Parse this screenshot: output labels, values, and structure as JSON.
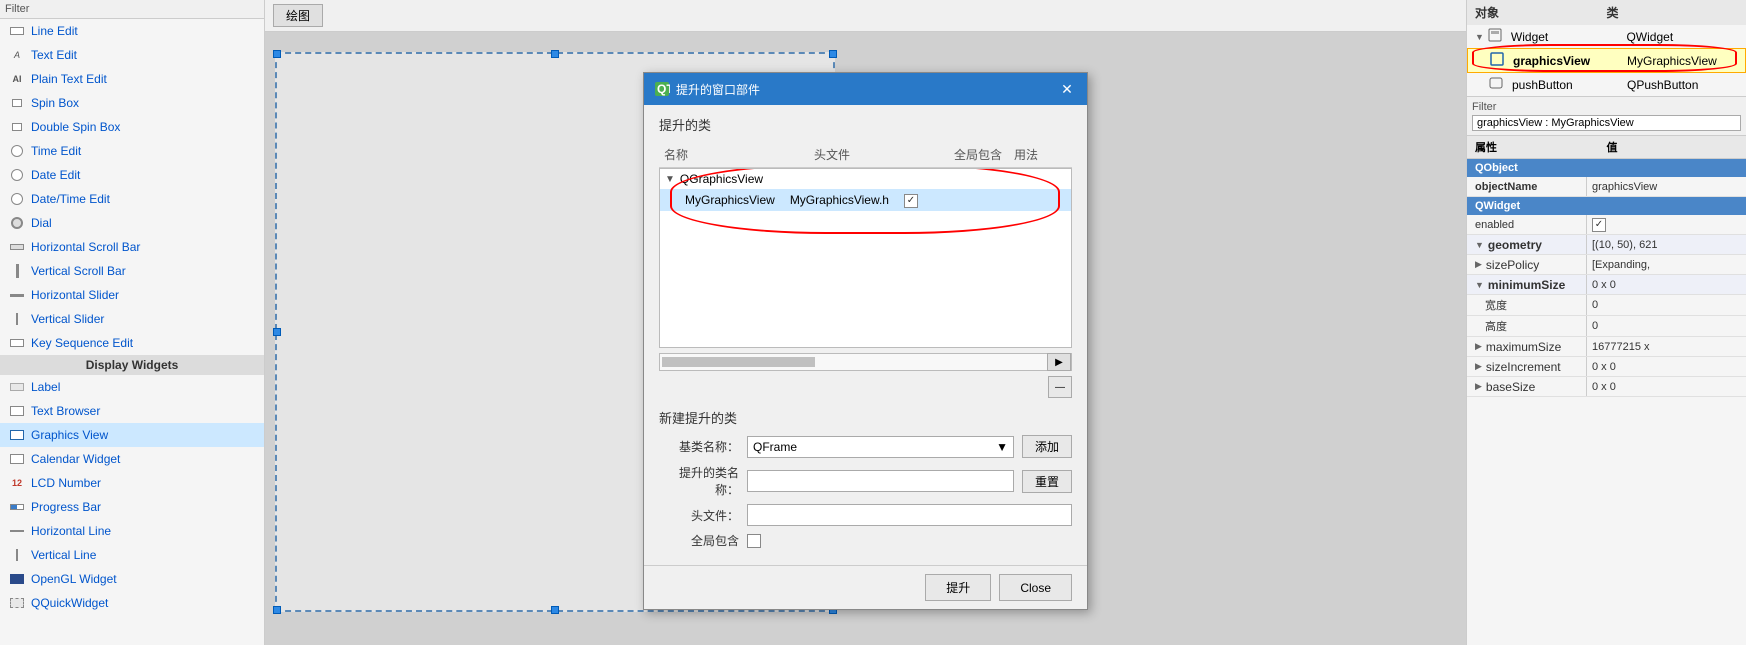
{
  "sidebar": {
    "filter_label": "Filter",
    "items": [
      {
        "id": "line-edit",
        "label": "Line Edit",
        "icon": "lineedit"
      },
      {
        "id": "text-edit",
        "label": "Text Edit",
        "icon": "textedit"
      },
      {
        "id": "plain-text-edit",
        "label": "Plain Text Edit",
        "icon": "ai"
      },
      {
        "id": "spin-box",
        "label": "Spin Box",
        "icon": "spinbox"
      },
      {
        "id": "double-spin-box",
        "label": "Double Spin Box",
        "icon": "spinbox"
      },
      {
        "id": "time-edit",
        "label": "Time Edit",
        "icon": "clock"
      },
      {
        "id": "date-edit",
        "label": "Date Edit",
        "icon": "clock"
      },
      {
        "id": "datetime-edit",
        "label": "Date/Time Edit",
        "icon": "clock"
      },
      {
        "id": "dial",
        "label": "Dial",
        "icon": "dial"
      },
      {
        "id": "hscrollbar",
        "label": "Horizontal Scroll Bar",
        "icon": "scrollbar"
      },
      {
        "id": "vscrollbar",
        "label": "Vertical Scroll Bar",
        "icon": "scrollbar"
      },
      {
        "id": "hslider",
        "label": "Horizontal Slider",
        "icon": "slider"
      },
      {
        "id": "vslider",
        "label": "Vertical Slider",
        "icon": "slider"
      },
      {
        "id": "keyseq",
        "label": "Key Sequence Edit",
        "icon": "keyseq"
      }
    ],
    "display_section": "Display Widgets",
    "display_items": [
      {
        "id": "label",
        "label": "Label",
        "icon": "label"
      },
      {
        "id": "text-browser",
        "label": "Text Browser",
        "icon": "browser"
      },
      {
        "id": "graphics-view",
        "label": "Graphics View",
        "icon": "graphicsview",
        "highlighted": true
      },
      {
        "id": "calendar-widget",
        "label": "Calendar Widget",
        "icon": "calwidget"
      },
      {
        "id": "lcd-number",
        "label": "LCD Number",
        "icon": "lcdnum"
      },
      {
        "id": "progress-bar",
        "label": "Progress Bar",
        "icon": "progbar"
      },
      {
        "id": "horizontal-line",
        "label": "Horizontal Line",
        "icon": "hline"
      },
      {
        "id": "vertical-line",
        "label": "Vertical Line",
        "icon": "vline"
      },
      {
        "id": "opengl-widget",
        "label": "OpenGL Widget",
        "icon": "opengl"
      },
      {
        "id": "qquick-widget",
        "label": "QQuickWidget",
        "icon": "quick"
      }
    ]
  },
  "canvas": {
    "toolbar_btn": "绘图"
  },
  "dialog": {
    "title": "提升的窗口部件",
    "section1_title": "提升的类",
    "col_name": "名称",
    "col_header": "头文件",
    "col_global": "全局包含",
    "col_usage": "用法",
    "tree": {
      "parent": "QGraphicsView",
      "child_name": "MyGraphicsView",
      "child_header": "MyGraphicsView.h",
      "child_checked": true
    },
    "section2_title": "新建提升的类",
    "label_base": "基类名称：",
    "base_value": "QFrame",
    "label_promoted": "提升的类名称：",
    "promoted_value": "",
    "label_header": "头文件：",
    "header_value": "",
    "label_global": "全局包含",
    "global_checked": false,
    "btn_add": "添加",
    "btn_reset": "重置",
    "btn_promote": "提升",
    "btn_close": "Close"
  },
  "right_panel": {
    "header_object": "对象",
    "header_class": "类",
    "tree_items": [
      {
        "id": "widget",
        "label": "Widget",
        "class": "QWidget",
        "level": 1,
        "icon": "widget"
      },
      {
        "id": "graphicsview",
        "label": "graphicsView",
        "class": "MyGraphicsView",
        "level": 2,
        "highlighted": true
      },
      {
        "id": "pushbutton",
        "label": "pushButton",
        "class": "QPushButton",
        "level": 2
      }
    ],
    "filter_label": "Filter",
    "filter_value": "graphicsView : MyGraphicsView",
    "props_header": "属性",
    "props_value_header": "值",
    "properties": [
      {
        "section": "QObject",
        "type": "section"
      },
      {
        "name": "objectName",
        "value": "graphicsView",
        "bold": true
      },
      {
        "section": "QWidget",
        "type": "section"
      },
      {
        "name": "enabled",
        "value": "☑",
        "type": "checkbox"
      },
      {
        "name": "geometry",
        "value": "[(10, 50), 621",
        "expand": true,
        "bold": true
      },
      {
        "name": "sizePolicy",
        "value": "[Expanding,",
        "expand": true
      },
      {
        "name": "minimumSize",
        "value": "0 x 0",
        "expand": true,
        "bold": true
      },
      {
        "name": "  宽度",
        "value": "0"
      },
      {
        "name": "  高度",
        "value": "0"
      },
      {
        "name": "maximumSize",
        "value": "16777215 x",
        "expand": true
      },
      {
        "name": "sizeIncrement",
        "value": "0 x 0",
        "expand": true
      },
      {
        "name": "baseSize",
        "value": "0 x 0",
        "expand": true
      }
    ]
  }
}
